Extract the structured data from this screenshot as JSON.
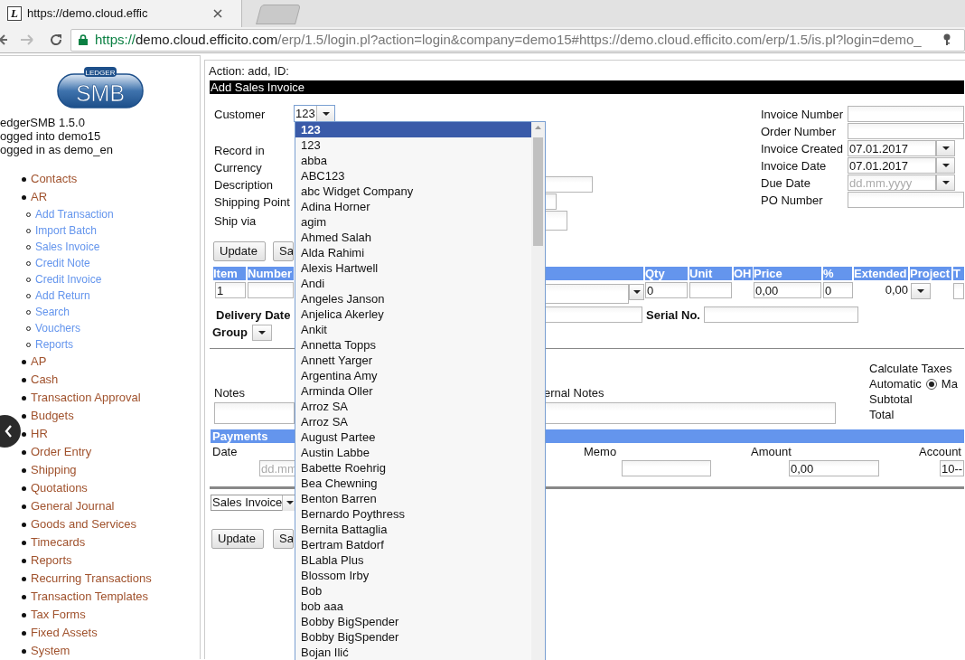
{
  "browser": {
    "favicon_letter": "L",
    "tab_title": "https://demo.cloud.effic",
    "url": [
      {
        "kind": "scheme",
        "text": "https://"
      },
      {
        "kind": "host",
        "text": "demo.cloud.efficito.com"
      },
      {
        "kind": "path",
        "text": "/erp/1.5/login.pl?action=login&company=demo15#https://demo.cloud.efficito.com/erp/1.5/is.pl?login=demo_"
      }
    ]
  },
  "sidebar": {
    "logo_small": "LEDGER",
    "logo_big": "SMB",
    "info": [
      "edgerSMB 1.5.0",
      "ogged into demo15",
      "ogged in as demo_en"
    ],
    "menu": [
      {
        "label": "Contacts"
      },
      {
        "label": "AR",
        "children": [
          {
            "label": "Add Transaction"
          },
          {
            "label": "Import Batch"
          },
          {
            "label": "Sales Invoice"
          },
          {
            "label": "Credit Note"
          },
          {
            "label": "Credit Invoice"
          },
          {
            "label": "Add Return"
          },
          {
            "label": "Search"
          },
          {
            "label": "Vouchers"
          },
          {
            "label": "Reports"
          }
        ]
      },
      {
        "label": "AP"
      },
      {
        "label": "Cash"
      },
      {
        "label": "Transaction Approval"
      },
      {
        "label": "Budgets"
      },
      {
        "label": "HR"
      },
      {
        "label": "Order Entry"
      },
      {
        "label": "Shipping"
      },
      {
        "label": "Quotations"
      },
      {
        "label": "General Journal"
      },
      {
        "label": "Goods and Services"
      },
      {
        "label": "Timecards"
      },
      {
        "label": "Reports"
      },
      {
        "label": "Recurring Transactions"
      },
      {
        "label": "Transaction Templates"
      },
      {
        "label": "Tax Forms"
      },
      {
        "label": "Fixed Assets"
      },
      {
        "label": "System"
      }
    ]
  },
  "action_line": "Action: add, ID:",
  "title": "Add Sales Invoice",
  "left_fields": [
    {
      "label": "Customer",
      "kind": "select",
      "value": "123"
    },
    {
      "label": "Record in",
      "kind": "none"
    },
    {
      "label": "Currency",
      "kind": "none"
    },
    {
      "label": "Description",
      "kind": "input"
    },
    {
      "label": "Shipping Point",
      "kind": "input"
    },
    {
      "label": "Ship via",
      "kind": "textarea"
    }
  ],
  "right_fields": [
    {
      "label": "Invoice Number",
      "kind": "input"
    },
    {
      "label": "Order Number",
      "kind": "input"
    },
    {
      "label": "Invoice Created",
      "kind": "date",
      "value": "07.01.2017"
    },
    {
      "label": "Invoice Date",
      "kind": "date",
      "value": "07.01.2017"
    },
    {
      "label": "Due Date",
      "kind": "date",
      "placeholder": "dd.mm.yyyy"
    },
    {
      "label": "PO Number",
      "kind": "input"
    }
  ],
  "top_buttons": [
    "Update",
    "Sa"
  ],
  "lines": {
    "columns": [
      "Item",
      "Number",
      "",
      "Qty",
      "Unit",
      "OH",
      "Price",
      "%",
      "Extended",
      "Project",
      "T"
    ],
    "row": {
      "item": "1",
      "qty": "0",
      "price": "0,00",
      "discount": "0",
      "extended": "0,00"
    }
  },
  "delivery_date_label": "Delivery Date",
  "serial_label": "Serial No.",
  "group_label": "Group",
  "notes_label": "Notes",
  "internal_notes_label": "ernal Notes",
  "taxes": {
    "heading": "Calculate Taxes",
    "automatic_label": "Automatic",
    "manual_checked": true,
    "manual_label": "Ma",
    "subtotal_label": "Subtotal",
    "total_label": "Total"
  },
  "payments": {
    "title": "Payments",
    "columns": [
      "Date",
      "Memo",
      "Amount",
      "Account"
    ],
    "date_placeholder": "dd.mm",
    "amount": "0,00",
    "account": "10--"
  },
  "form_select": "Sales Invoice",
  "bottom_buttons": [
    "Update",
    "Sa"
  ],
  "customer_dropdown": {
    "options": [
      {
        "label": "123",
        "selected": true
      },
      {
        "label": "123",
        "selected": false
      },
      {
        "label": "abba",
        "selected": false
      },
      {
        "label": "ABC123",
        "selected": false
      },
      {
        "label": "abc Widget Company",
        "selected": false
      },
      {
        "label": "Adina Horner",
        "selected": false
      },
      {
        "label": "agim",
        "selected": false
      },
      {
        "label": "Ahmed Salah",
        "selected": false
      },
      {
        "label": "Alda Rahimi",
        "selected": false
      },
      {
        "label": "Alexis Hartwell",
        "selected": false
      },
      {
        "label": "Andi",
        "selected": false
      },
      {
        "label": "Angeles Janson",
        "selected": false
      },
      {
        "label": "Anjelica Akerley",
        "selected": false
      },
      {
        "label": "Ankit",
        "selected": false
      },
      {
        "label": "Annetta Topps",
        "selected": false
      },
      {
        "label": "Annett Yarger",
        "selected": false
      },
      {
        "label": "Argentina Amy",
        "selected": false
      },
      {
        "label": "Arminda Oller",
        "selected": false
      },
      {
        "label": "Arroz SA",
        "selected": false
      },
      {
        "label": "Arroz SA",
        "selected": false
      },
      {
        "label": "August Partee",
        "selected": false
      },
      {
        "label": "Austin Labbe",
        "selected": false
      },
      {
        "label": "Babette Roehrig",
        "selected": false
      },
      {
        "label": "Bea Chewning",
        "selected": false
      },
      {
        "label": "Benton Barren",
        "selected": false
      },
      {
        "label": "Bernardo Poythress",
        "selected": false
      },
      {
        "label": "Bernita Battaglia",
        "selected": false
      },
      {
        "label": "Bertram Batdorf",
        "selected": false
      },
      {
        "label": "BLabla Plus",
        "selected": false
      },
      {
        "label": "Blossom Irby",
        "selected": false
      },
      {
        "label": "Bob",
        "selected": false
      },
      {
        "label": "bob aaa",
        "selected": false
      },
      {
        "label": "Bobby BigSpender",
        "selected": false
      },
      {
        "label": "Bobby BigSpender",
        "selected": false
      },
      {
        "label": "Bojan Ilić",
        "selected": false
      }
    ]
  }
}
